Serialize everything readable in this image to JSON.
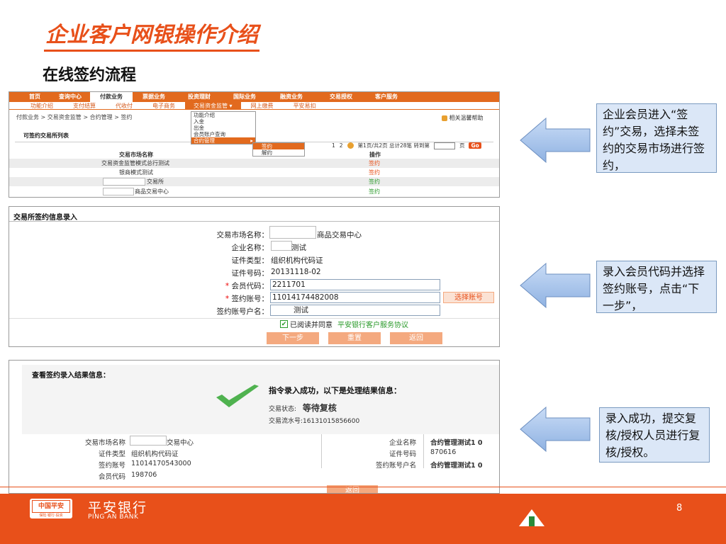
{
  "header": {
    "title": "企业客户网银操作介绍",
    "subtitle": "在线签约流程"
  },
  "shot1": {
    "nav": [
      "首页",
      "查询中心",
      "付款业务",
      "票据业务",
      "投资理财",
      "国际业务",
      "融资业务",
      "交易授权",
      "客户服务"
    ],
    "subnav": [
      "功能介绍",
      "支付结算",
      "代收付",
      "电子商务",
      "交易资金监管",
      "网上缴费",
      "平安易扣"
    ],
    "subnav_arrow": "▾",
    "breadcrumb": "付款业务 > 交易资金监管 > 合约管理 > 签约",
    "help": "相关温馨帮助",
    "dropdown1": [
      "功能介绍",
      "入金",
      "出金",
      "会员账户查询",
      "合约管理"
    ],
    "dropdown1_arrow": "▸",
    "dropdown2": [
      "签约",
      "解约"
    ],
    "section": "可签约交易所列表",
    "pager": {
      "p1": "1",
      "p2": "2",
      "info": "第1页/共2页 总计28笔 转到第",
      "unit": "页",
      "go": "Go"
    },
    "col_market": "交易市场名称",
    "col_op": "操作",
    "rows": [
      {
        "name": "交易资金监管模式总行测试",
        "op": "签约"
      },
      {
        "name": "银商模式测试",
        "op": "签约"
      },
      {
        "name": "交易所",
        "op": "签约"
      },
      {
        "name": "商品交易中心",
        "op": "签约"
      }
    ]
  },
  "shot2": {
    "heading": "交易所签约信息录入",
    "fields": [
      {
        "label": "交易市场名称：",
        "value": "商品交易中心"
      },
      {
        "label": "企业名称：",
        "value": "测试"
      },
      {
        "label": "证件类型：",
        "value": "组织机构代码证"
      },
      {
        "label": "证件号码：",
        "value": "20131118-02"
      }
    ],
    "star": "*",
    "member_label": "会员代码：",
    "member_value": "2211701",
    "account_label": "签约账号：",
    "account_value": "11014174482008",
    "select_account": "选择账号",
    "holder_label": "签约账号户名：",
    "holder_value": "测试",
    "agree_text": "已阅读并同意",
    "agree_link": "平安银行客户服务协议",
    "check": "✔",
    "buttons": [
      "下一步",
      "重置",
      "返回"
    ]
  },
  "shot3": {
    "heading": "查看签约录入结果信息：",
    "success": "指令录入成功，以下是处理结果信息：",
    "status_label": "交易状态:",
    "status_value": "等待复核",
    "serial": "交易流水号:16131015856600",
    "left": [
      {
        "label": "交易市场名称",
        "value": "交易中心"
      },
      {
        "label": "证件类型",
        "value": "组织机构代码证"
      },
      {
        "label": "签约账号",
        "value": "11014170543000"
      },
      {
        "label": "会员代码",
        "value": "198706"
      }
    ],
    "right": [
      {
        "label": "企业名称",
        "value": "合约管理测试1 0"
      },
      {
        "label": "证件号码",
        "value": "870616"
      },
      {
        "label": "签约账号户名",
        "value": "合约管理测试1 0"
      }
    ],
    "back": "返回"
  },
  "callouts": [
    "企业会员进入“签约”交易，选择未签约的交易市场进行签约，",
    "录入会员代码并选择签约账号，点击“下一步”，",
    "录入成功，提交复核/授权人员进行复核/授权。"
  ],
  "footer": {
    "badge": "中国平安",
    "badge_sub": "保险·银行·投资",
    "bank_cn": "平安银行",
    "bank_en": "PING AN BANK",
    "page": "8"
  },
  "colors": {
    "accent": "#e8501a",
    "callout_bg": "#dbe7f7",
    "arrow": "#a9c6ee"
  }
}
